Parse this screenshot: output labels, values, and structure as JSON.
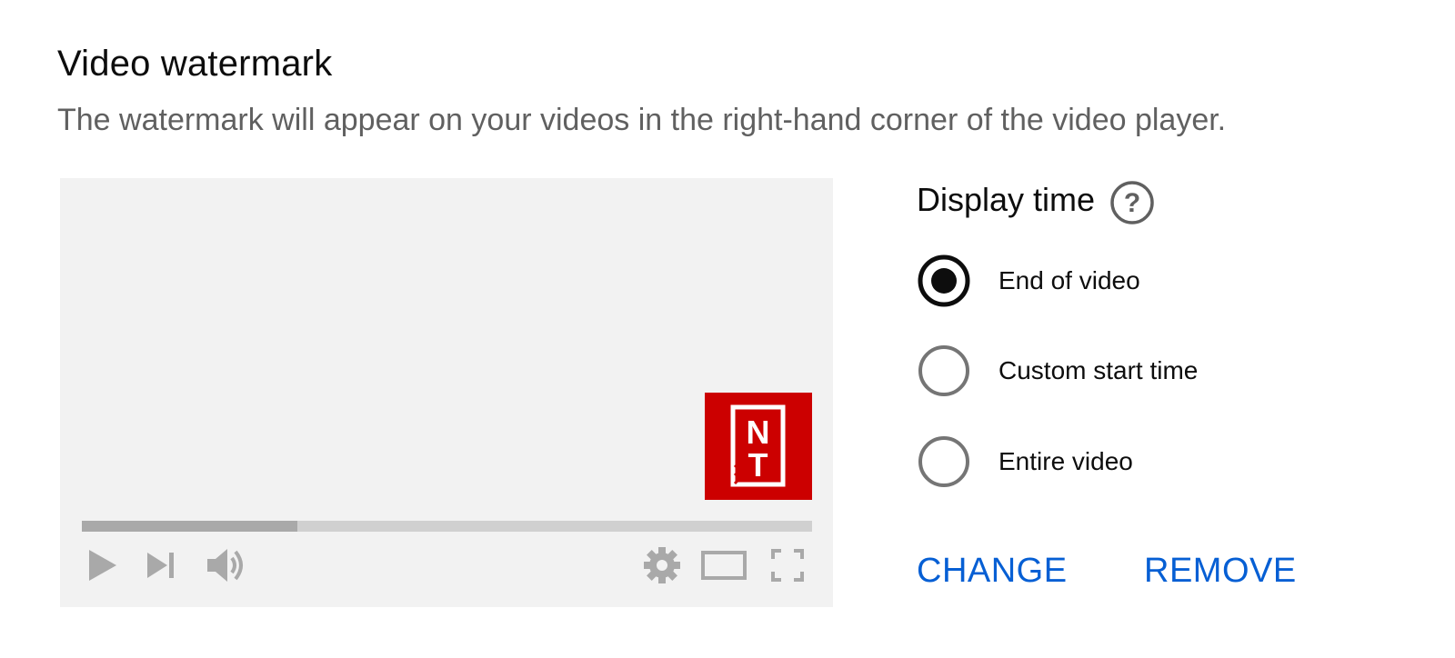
{
  "section": {
    "title": "Video watermark",
    "description": "The watermark will appear on your videos in the right-hand corner of the video player."
  },
  "preview": {
    "watermark_logo_text": "NT",
    "progress_fraction": 0.295,
    "controls": [
      "play-icon",
      "next-icon",
      "volume-icon",
      "gear-icon",
      "theater-mode-icon",
      "fullscreen-icon"
    ]
  },
  "display_time": {
    "label": "Display time",
    "help_icon": "help-circle-icon",
    "options": [
      {
        "label": "End of video",
        "selected": true
      },
      {
        "label": "Custom start time",
        "selected": false
      },
      {
        "label": "Entire video",
        "selected": false
      }
    ]
  },
  "actions": {
    "change_label": "CHANGE",
    "remove_label": "REMOVE"
  },
  "colors": {
    "accent": "#065fd4",
    "watermark_bg": "#cc0000",
    "player_bg": "#f2f2f2",
    "radio_unselected": "#757575",
    "radio_selected": "#0d0d0d"
  }
}
